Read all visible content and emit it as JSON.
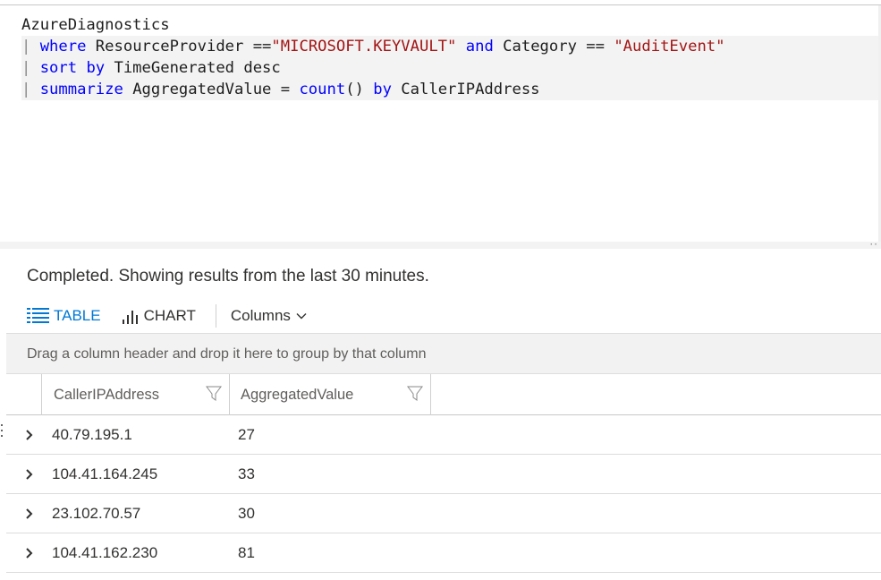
{
  "editor": {
    "lines": [
      [
        {
          "t": "AzureDiagnostics",
          "c": "id"
        }
      ],
      [
        {
          "t": "| ",
          "c": "pipe"
        },
        {
          "t": "where",
          "c": "kw"
        },
        {
          "t": " ResourceProvider ==",
          "c": "id"
        },
        {
          "t": "\"MICROSOFT.KEYVAULT\"",
          "c": "str"
        },
        {
          "t": " ",
          "c": "id"
        },
        {
          "t": "and",
          "c": "kw"
        },
        {
          "t": " Category == ",
          "c": "id"
        },
        {
          "t": "\"AuditEvent\"",
          "c": "str"
        }
      ],
      [
        {
          "t": "| ",
          "c": "pipe"
        },
        {
          "t": "sort by",
          "c": "kw"
        },
        {
          "t": " TimeGenerated desc",
          "c": "id"
        }
      ],
      [
        {
          "t": "| ",
          "c": "pipe"
        },
        {
          "t": "summarize",
          "c": "kw"
        },
        {
          "t": " AggregatedValue = ",
          "c": "id"
        },
        {
          "t": "count",
          "c": "kw"
        },
        {
          "t": "() ",
          "c": "id"
        },
        {
          "t": "by",
          "c": "kw"
        },
        {
          "t": " CallerIPAddress",
          "c": "id"
        }
      ]
    ]
  },
  "status": "Completed. Showing results from the last 30 minutes.",
  "toolbar": {
    "table_label": "TABLE",
    "chart_label": "CHART",
    "columns_label": "Columns",
    "accent": "#0078d4"
  },
  "group_bar": {
    "text": "Drag a column header and drop it here to group by that column"
  },
  "table": {
    "headers": [
      "CallerIPAddress",
      "AggregatedValue"
    ],
    "rows": [
      {
        "ip": "40.79.195.1",
        "value": "27"
      },
      {
        "ip": "104.41.164.245",
        "value": "33"
      },
      {
        "ip": "23.102.70.57",
        "value": "30"
      },
      {
        "ip": "104.41.162.230",
        "value": "81"
      }
    ]
  }
}
